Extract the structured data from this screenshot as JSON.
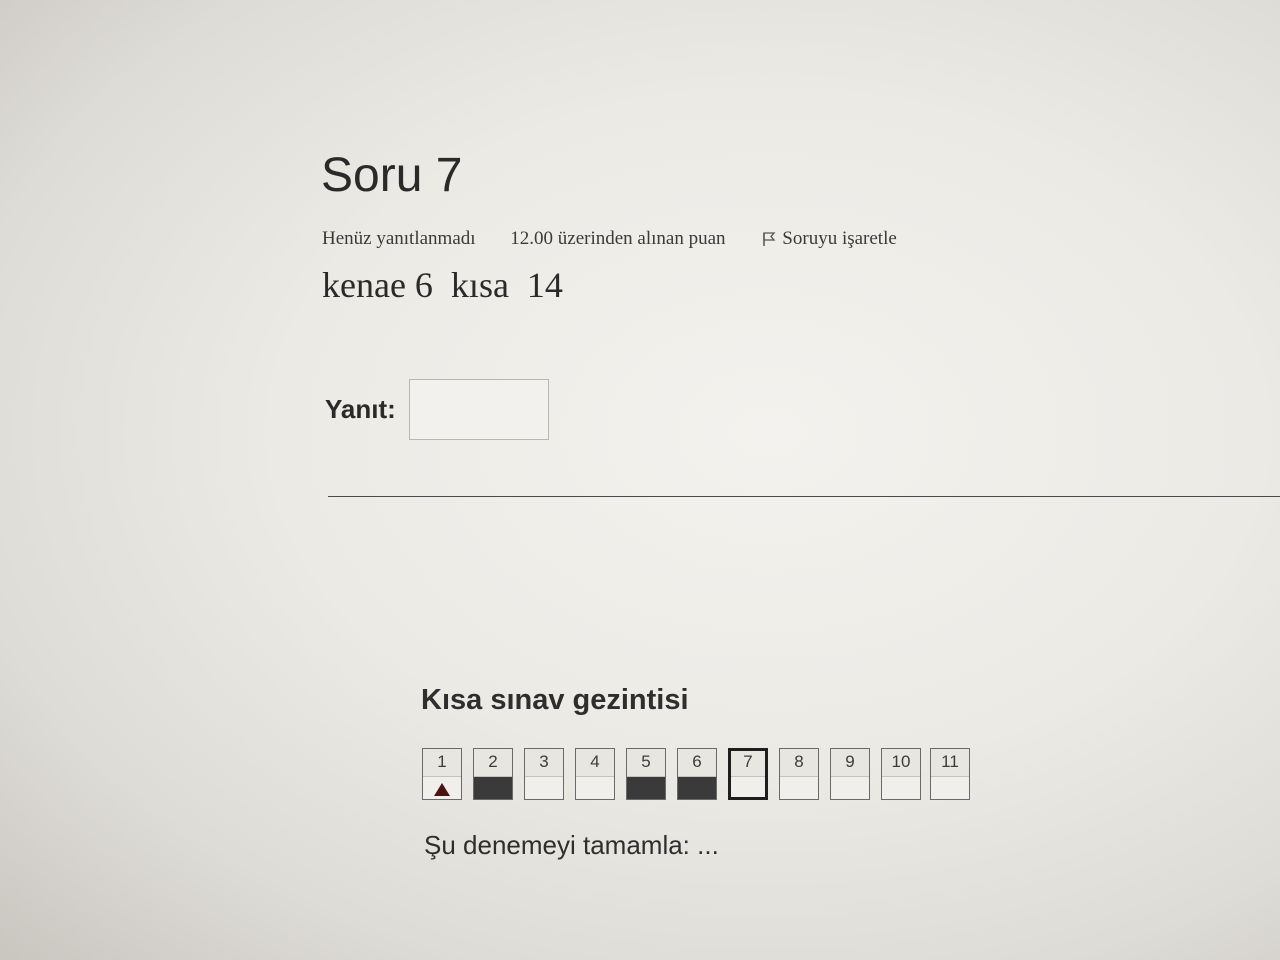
{
  "question": {
    "title": "Soru 7",
    "status": "Henüz yanıtlanmadı",
    "points": "12.00 üzerinden alınan puan",
    "flag_label": "Soruyu işaretle",
    "text": "kenae 6  kısa  14"
  },
  "answer": {
    "label": "Yanıt:",
    "value": "",
    "placeholder": ""
  },
  "navigation": {
    "title": "Kısa sınav gezintisi",
    "buttons": [
      {
        "label": "1",
        "state": "flagged"
      },
      {
        "label": "2",
        "state": "answered"
      },
      {
        "label": "3",
        "state": "empty"
      },
      {
        "label": "4",
        "state": "empty"
      },
      {
        "label": "5",
        "state": "answered"
      },
      {
        "label": "6",
        "state": "answered"
      },
      {
        "label": "7",
        "state": "current"
      },
      {
        "label": "8",
        "state": "empty"
      },
      {
        "label": "9",
        "state": "empty"
      },
      {
        "label": "10",
        "state": "empty"
      },
      {
        "label": "11",
        "state": "empty"
      }
    ],
    "finish_label": "Şu denemeyi tamamla: ..."
  },
  "icons": {
    "flag": "flag-icon",
    "flagged_marker": "triangle-flag-icon"
  },
  "colors": {
    "answered_fill": "#3a3a3a",
    "flag_marker": "#4a1410"
  }
}
